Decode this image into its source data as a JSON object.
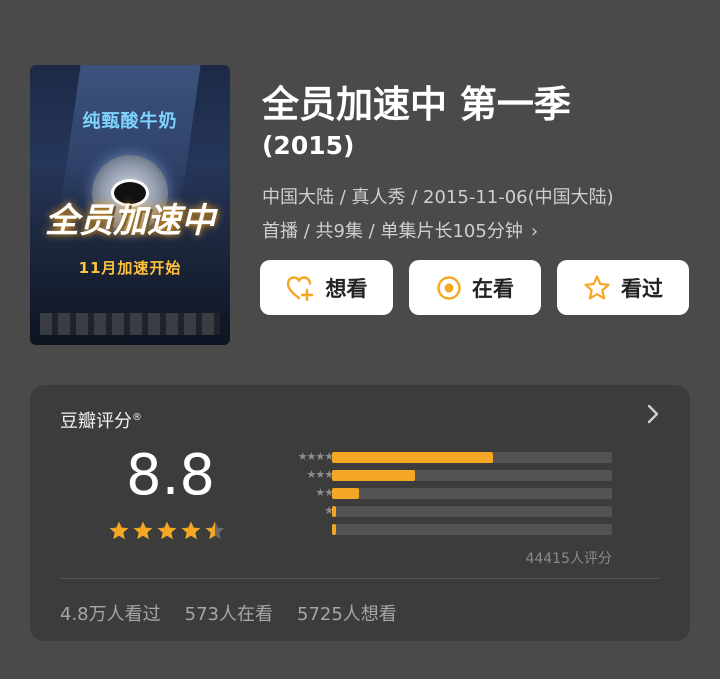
{
  "poster": {
    "brand_text": "纯甄酸牛奶",
    "show_name": "全员加速中",
    "tagline": "11月加速开始"
  },
  "title": "全员加速中 第一季",
  "year": "(2015)",
  "meta": {
    "line1": "中国大陆 / 真人秀 / 2015-11-06(中国大陆)",
    "line2": "首播 / 共9集 / 单集片长105分钟"
  },
  "actions": {
    "want_label": "想看",
    "watching_label": "在看",
    "watched_label": "看过"
  },
  "rating": {
    "section_title": "豆瓣评分",
    "trademark": "®",
    "score": "8.8",
    "stars": 4.5,
    "distribution": [
      {
        "stars": 5,
        "pct": 57.5
      },
      {
        "stars": 4,
        "pct": 29.5
      },
      {
        "stars": 3,
        "pct": 9.5
      },
      {
        "stars": 2,
        "pct": 1.5
      },
      {
        "stars": 1,
        "pct": 1.5
      }
    ],
    "count_text": "44415人评分",
    "watched_text": "4.8万人看过",
    "watching_text": "573人在看",
    "want_text": "5725人想看"
  },
  "colors": {
    "accent": "#f5a623",
    "card_bg": "#3c3c3c",
    "page_bg": "#4a4a4a"
  },
  "icons": {
    "want": "heart-plus-icon",
    "watching": "target-circle-icon",
    "watched": "star-outline-icon",
    "chevron": "chevron-right-icon"
  }
}
